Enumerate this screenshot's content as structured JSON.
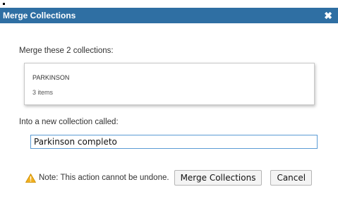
{
  "dialog": {
    "title": "Merge Collections",
    "close_symbol": "✖"
  },
  "merge": {
    "intro": "Merge these 2 collections:",
    "collections": [
      {
        "name": "PARKINSON",
        "count": "3 items"
      }
    ]
  },
  "target": {
    "label": "Into a new collection called:",
    "value": "Parkinson completo"
  },
  "footer": {
    "note": "Note: This action cannot be undone.",
    "merge_button": "Merge Collections",
    "cancel_button": "Cancel",
    "warning_icon": "warning-triangle",
    "warning_color": "#f2b01e"
  },
  "colors": {
    "titlebar": "#2f6fa3",
    "input_border": "#5b9bd5"
  }
}
